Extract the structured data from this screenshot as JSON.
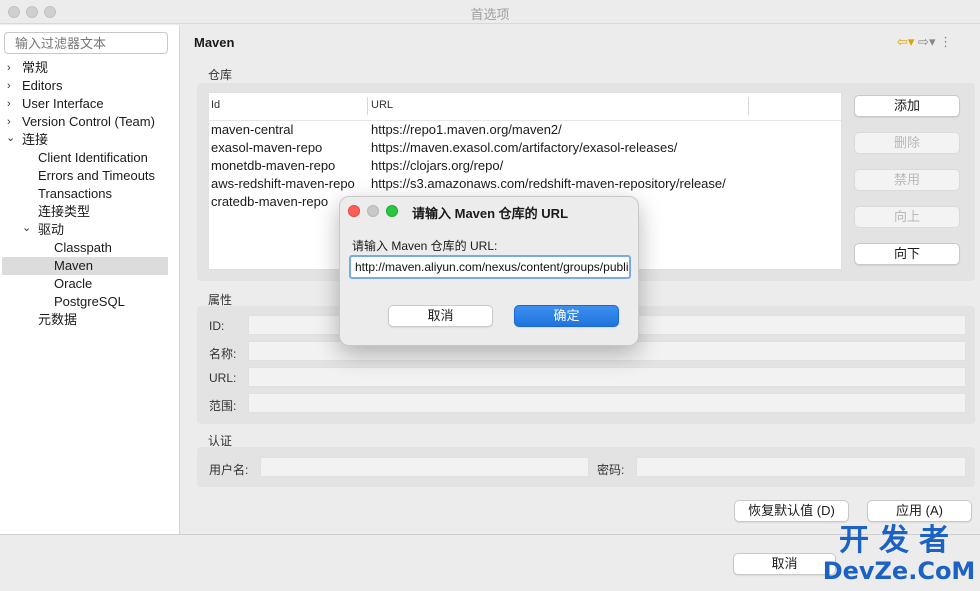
{
  "window": {
    "title": "首选项"
  },
  "sidebar": {
    "filter_placeholder": "输入过滤器文本",
    "items": [
      {
        "label": "常规",
        "chevron": "›"
      },
      {
        "label": "Editors",
        "chevron": "›"
      },
      {
        "label": "User Interface",
        "chevron": "›"
      },
      {
        "label": "Version Control (Team)",
        "chevron": "›"
      },
      {
        "label": "连接",
        "chevron": "⌄"
      },
      {
        "label": "Client Identification"
      },
      {
        "label": "Errors and Timeouts"
      },
      {
        "label": "Transactions"
      },
      {
        "label": "连接类型"
      },
      {
        "label": "驱动",
        "chevron": "⌄"
      },
      {
        "label": "Classpath"
      },
      {
        "label": "Maven",
        "selected": true
      },
      {
        "label": "Oracle"
      },
      {
        "label": "PostgreSQL"
      },
      {
        "label": "元数据"
      }
    ]
  },
  "main": {
    "title": "Maven",
    "repo_group_label": "仓库",
    "columns": [
      "Id",
      "URL"
    ],
    "rows": [
      {
        "id": "maven-central",
        "url": "https://repo1.maven.org/maven2/"
      },
      {
        "id": "exasol-maven-repo",
        "url": "https://maven.exasol.com/artifactory/exasol-releases/"
      },
      {
        "id": "monetdb-maven-repo",
        "url": "https://clojars.org/repo/"
      },
      {
        "id": "aws-redshift-maven-repo",
        "url": "https://s3.amazonaws.com/redshift-maven-repository/release/"
      },
      {
        "id": "cratedb-maven-repo",
        "url": ""
      }
    ],
    "buttons": {
      "add": "添加",
      "delete": "删除",
      "disable": "禁用",
      "up": "向上",
      "down": "向下"
    },
    "props_group_label": "属性",
    "props": {
      "id_label": "ID:",
      "name_label": "名称:",
      "url_label": "URL:",
      "scope_label": "范围:"
    },
    "auth_group_label": "认证",
    "auth": {
      "user_label": "用户名:",
      "password_label": "密码:"
    },
    "restore_defaults": "恢复默认值 (D)",
    "apply": "应用 (A)"
  },
  "footer": {
    "cancel": "取消"
  },
  "dialog": {
    "title": "请输入 Maven 仓库的 URL",
    "prompt": "请输入 Maven 仓库的 URL:",
    "url_value": "http://maven.aliyun.com/nexus/content/groups/public/",
    "cancel": "取消",
    "ok": "确定"
  },
  "watermark": {
    "line1": "开发者",
    "line2": "DevZe.CoM"
  },
  "colors": {
    "accent": "#1f74dd",
    "watermark": "#1b62c4",
    "close_dot": "#ff5f57",
    "min_dot": "#c8c8c8",
    "max_dot": "#28c840"
  }
}
